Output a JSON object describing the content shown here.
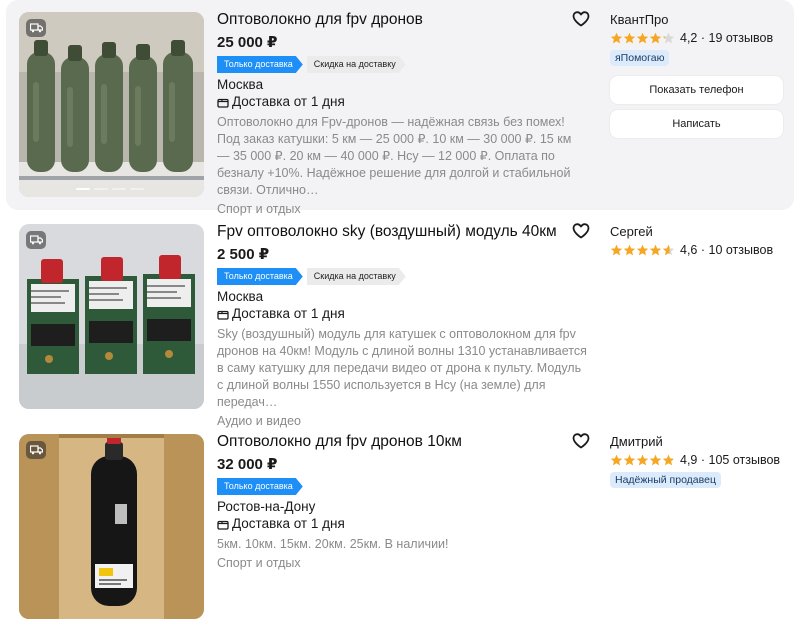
{
  "listings": [
    {
      "title": "Оптоволокно для fpv дронов",
      "price": "25 000 ₽",
      "tags": [
        "Только доставка",
        "Скидка на доставку"
      ],
      "city": "Москва",
      "delivery": "Доставка от 1 дня",
      "description": "Оптоволокно для Fpv-дронов — надёжная связь без помех! Под заказ катушки: 5 км — 25 000 ₽. 10 км — 30 000 ₽. 15 км — 35 000 ₽. 20 км — 40 000 ₽. Нсу — 12 000 ₽. Оплата по безналу +10%. Надёжное решение для долгой и стабильной связи. Отлично…",
      "category": "Спорт и отдых",
      "seller": {
        "name": "КвантПро",
        "rating": 4.2,
        "rating_text": "4,2",
        "reviews": "19 отзывов",
        "badge": "яПомогаю"
      },
      "buttons": {
        "phone": "Показать телефон",
        "write": "Написать"
      }
    },
    {
      "title": "Fpv оптоволокно sky (воздушный) модуль 40км",
      "price": "2 500 ₽",
      "tags": [
        "Только доставка",
        "Скидка на доставку"
      ],
      "city": "Москва",
      "delivery": "Доставка от 1 дня",
      "description": "Sky (воздушный) модуль для катушек с оптоволокном для fpv дронов на 40км! Модуль с длиной волны 1310 устанавливается в саму катушку для передачи видео от дрона к пульту. Модуль с длиной волны 1550 используется в Нсу (на земле) для передач…",
      "category": "Аудио и видео",
      "seller": {
        "name": "Сергей",
        "rating": 4.6,
        "rating_text": "4,6",
        "reviews": "10 отзывов"
      }
    },
    {
      "title": "Оптоволокно для fpv дронов 10км",
      "price": "32 000 ₽",
      "tags": [
        "Только доставка"
      ],
      "city": "Ростов-на-Дону",
      "delivery": "Доставка от 1 дня",
      "description": "5км. 10км. 15км. 20км. 25км. В наличии!",
      "category": "Спорт и отдых",
      "seller": {
        "name": "Дмитрий",
        "rating": 4.9,
        "rating_text": "4,9",
        "reviews": "105 отзывов",
        "badge": "Надёжный продавец"
      }
    }
  ],
  "icons": {
    "favorite": "heart-outline-icon",
    "delivery": "box-icon",
    "photo_badge": "delivery-truck-icon",
    "star": "star-icon"
  },
  "colors": {
    "accent_blue": "#1e8ff6",
    "star": "#f5a623",
    "badge_bg": "#dcebfb",
    "muted_text": "#8a8a8a"
  }
}
